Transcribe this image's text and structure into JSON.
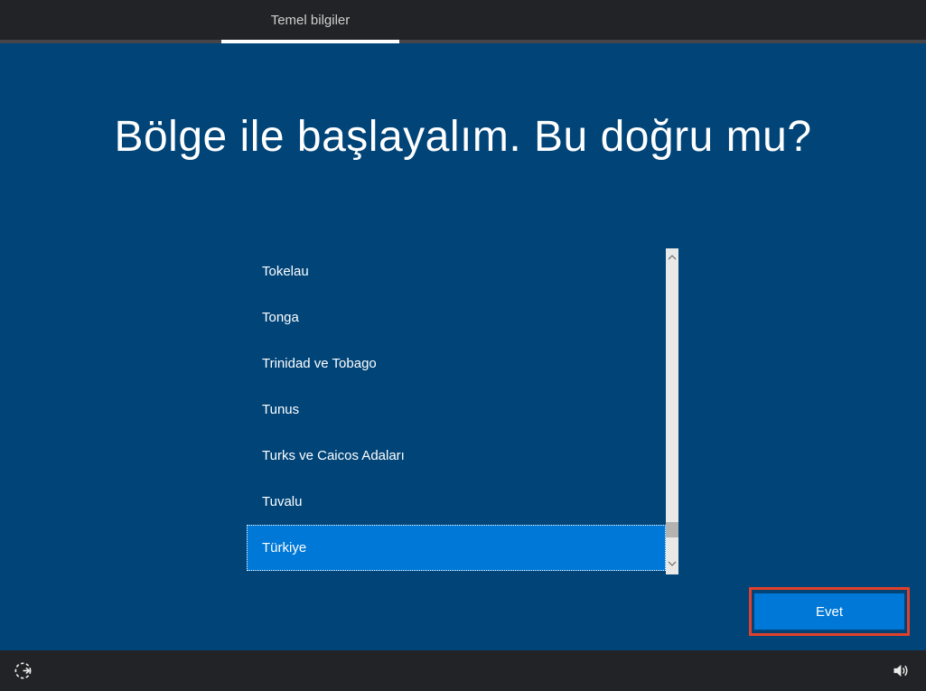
{
  "topbar": {
    "tab": "Temel bilgiler"
  },
  "main": {
    "title": "Bölge ile başlayalım. Bu doğru mu?",
    "region_list": {
      "items": [
        "Tokelau",
        "Tonga",
        "Trinidad ve Tobago",
        "Tunus",
        "Turks ve Caicos Adaları",
        "Tuvalu",
        "Türkiye"
      ],
      "selected": "Türkiye",
      "selected_index": 6
    },
    "confirm_button": "Evet"
  },
  "footer": {
    "ease_of_access_icon": "ease-of-access-icon",
    "volume_icon": "volume-icon"
  },
  "colors": {
    "background": "#004478",
    "accent_blue": "#0078d7",
    "bar_dark": "#222326",
    "annotation_red": "#e2402a",
    "tab_text": "#cfcfcf",
    "scroll_track": "#e9e9e7",
    "scroll_thumb": "#b3b3b1"
  }
}
